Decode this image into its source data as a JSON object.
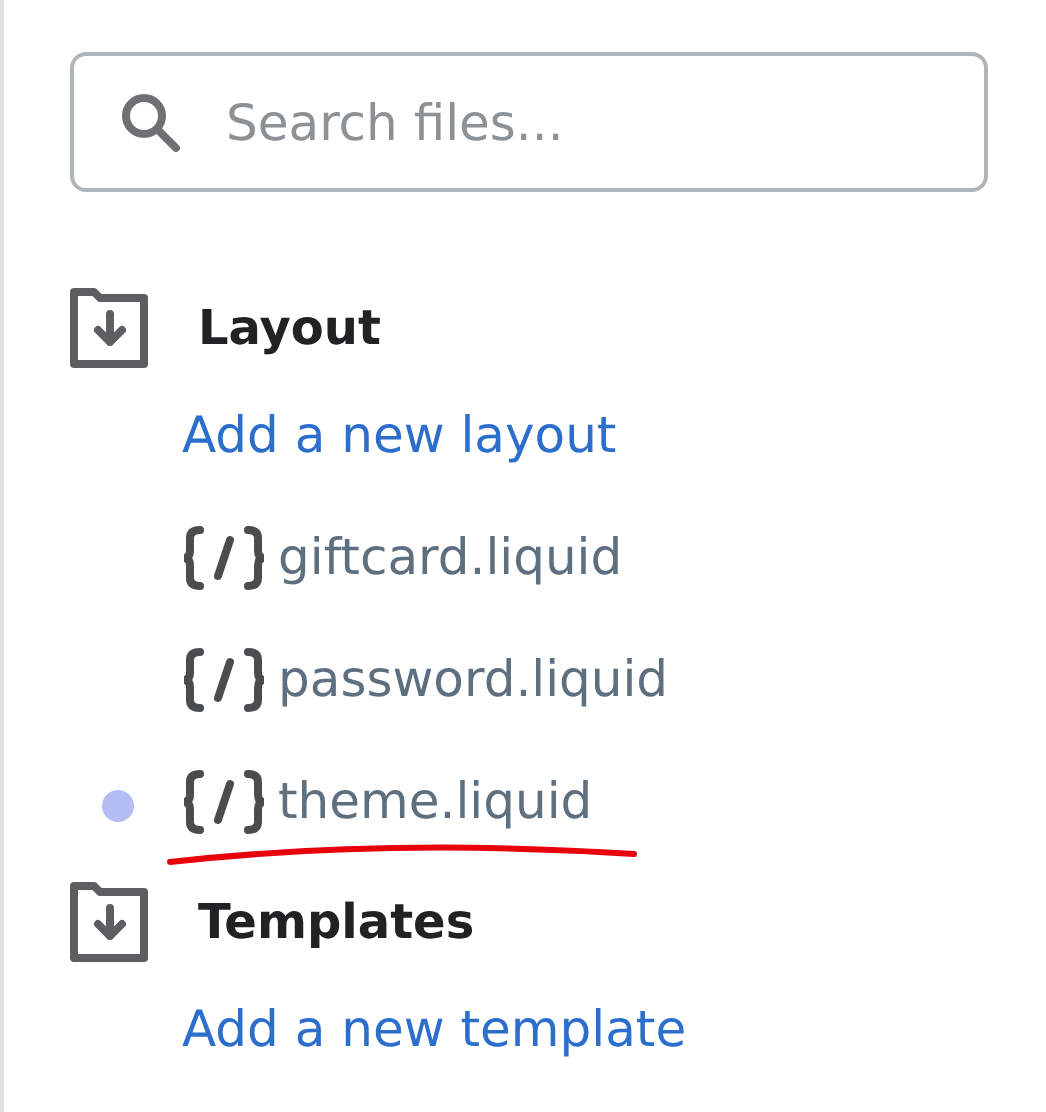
{
  "search": {
    "placeholder": "Search files..."
  },
  "sections": [
    {
      "title": "Layout",
      "add_link": "Add a new layout",
      "files": [
        {
          "name": "giftcard.liquid",
          "modified": false,
          "underlined": false
        },
        {
          "name": "password.liquid",
          "modified": false,
          "underlined": false
        },
        {
          "name": "theme.liquid",
          "modified": true,
          "underlined": true
        }
      ]
    },
    {
      "title": "Templates",
      "add_link": "Add a new template"
    }
  ]
}
